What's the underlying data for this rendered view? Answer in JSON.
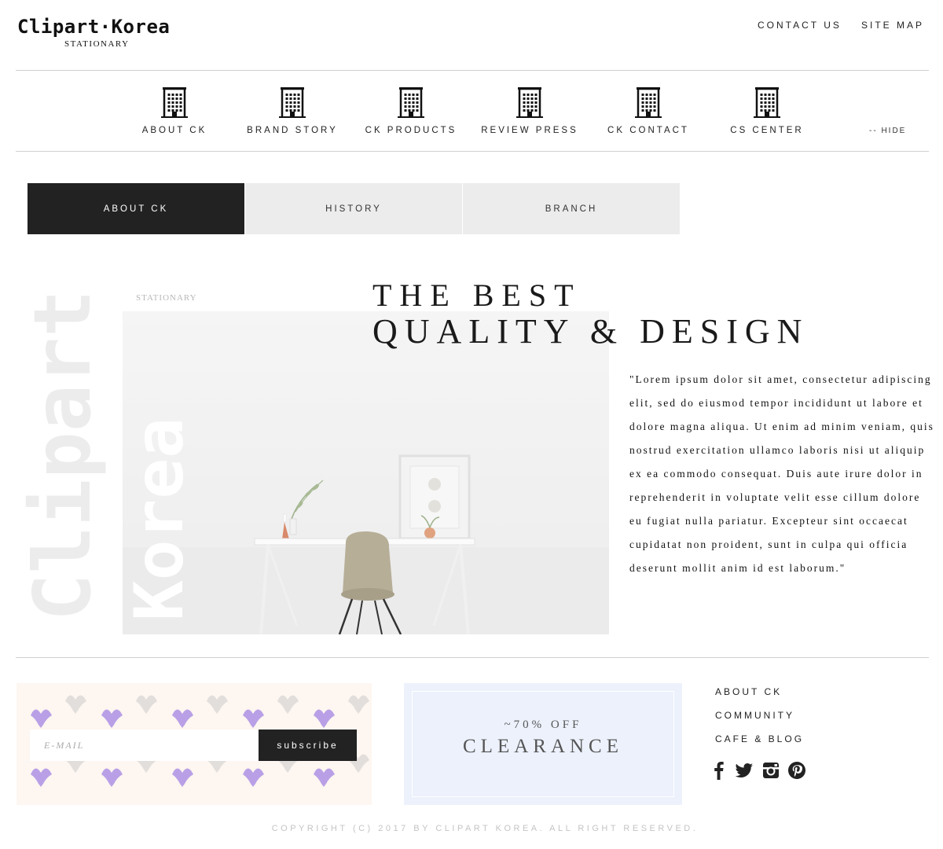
{
  "header": {
    "logo": "Clipart·Korea",
    "logo_sub": "STATIONARY",
    "links": [
      "CONTACT US",
      "SITE MAP"
    ]
  },
  "nav": {
    "items": [
      {
        "label": "ABOUT CK",
        "icon": "building-icon"
      },
      {
        "label": "BRAND STORY",
        "icon": "building-icon"
      },
      {
        "label": "CK PRODUCTS",
        "icon": "building-icon"
      },
      {
        "label": "REVIEW PRESS",
        "icon": "building-icon"
      },
      {
        "label": "CK CONTACT",
        "icon": "building-icon"
      },
      {
        "label": "CS CENTER",
        "icon": "building-icon"
      }
    ],
    "hide_label": "--  HIDE"
  },
  "tabs": [
    {
      "label": "ABOUT CK",
      "active": true
    },
    {
      "label": "HISTORY",
      "active": false
    },
    {
      "label": "BRANCH",
      "active": false
    }
  ],
  "hero": {
    "watermark_1": "Clipart",
    "watermark_2": "Korea",
    "small_label": "STATIONARY",
    "headline_1": "THE BEST",
    "headline_2": "QUALITY & DESIGN",
    "paragraph": "\"Lorem ipsum dolor sit amet, consectetur adipiscing elit, sed do eiusmod tempor incididunt ut labore et dolore magna aliqua. Ut enim ad minim veniam, quis nostrud exercitation ullamco laboris nisi ut aliquip ex ea commodo consequat. Duis aute irure dolor in reprehenderit in voluptate velit esse cillum dolore eu fugiat nulla pariatur. Excepteur sint occaecat cupidatat non proident, sunt in culpa qui officia deserunt mollit anim id est laborum.\""
  },
  "newsletter": {
    "placeholder": "E-MAIL",
    "button": "subscribe"
  },
  "clearance": {
    "off": "~70% OFF",
    "title": "CLEARANCE"
  },
  "footer_links": [
    "ABOUT CK",
    "COMMUNITY",
    "CAFE & BLOG"
  ],
  "social": [
    "facebook-icon",
    "twitter-icon",
    "instagram-icon",
    "pinterest-icon"
  ],
  "copyright": "COPYRIGHT (C) 2017 BY CLIPART KOREA. ALL RIGHT RESERVED.",
  "colors": {
    "dark": "#222222",
    "tab_inactive": "#ececec",
    "newsletter_bg": "#fdf6f1",
    "clearance_bg": "#ecf1fc",
    "bird_purple": "#b9a0e6",
    "bird_grey": "#e2dedb"
  }
}
